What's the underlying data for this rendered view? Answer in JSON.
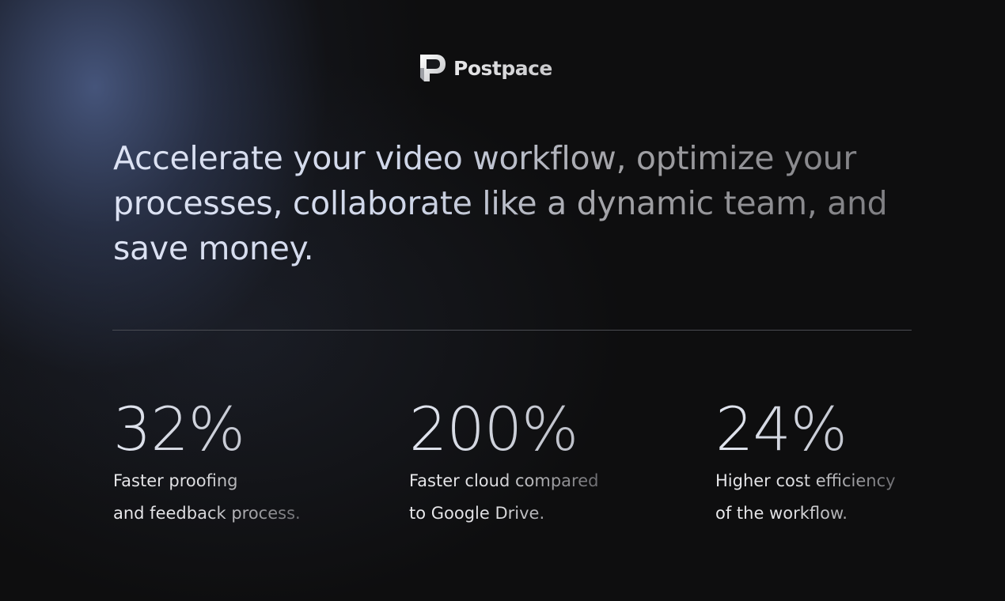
{
  "brand": {
    "name": "Postpace",
    "logo_icon": "postpace-logo-icon"
  },
  "headline": "Accelerate your video workflow, optimize your processes, collaborate like a dynamic team, and save money.",
  "stats": [
    {
      "value": "32%",
      "desc_line1": "Faster proofing",
      "desc_line2": "and feedback process."
    },
    {
      "value": "200%",
      "desc_line1": "Faster cloud compared",
      "desc_line2": "to Google Drive."
    },
    {
      "value": "24%",
      "desc_line1": "Higher cost efficiency",
      "desc_line2": "of the workflow."
    }
  ],
  "colors": {
    "background": "#0e0e0f",
    "glow": "#485880",
    "divider": "#4a4c52",
    "text_light": "#dde3f4",
    "text_muted": "#7a7a7e"
  }
}
